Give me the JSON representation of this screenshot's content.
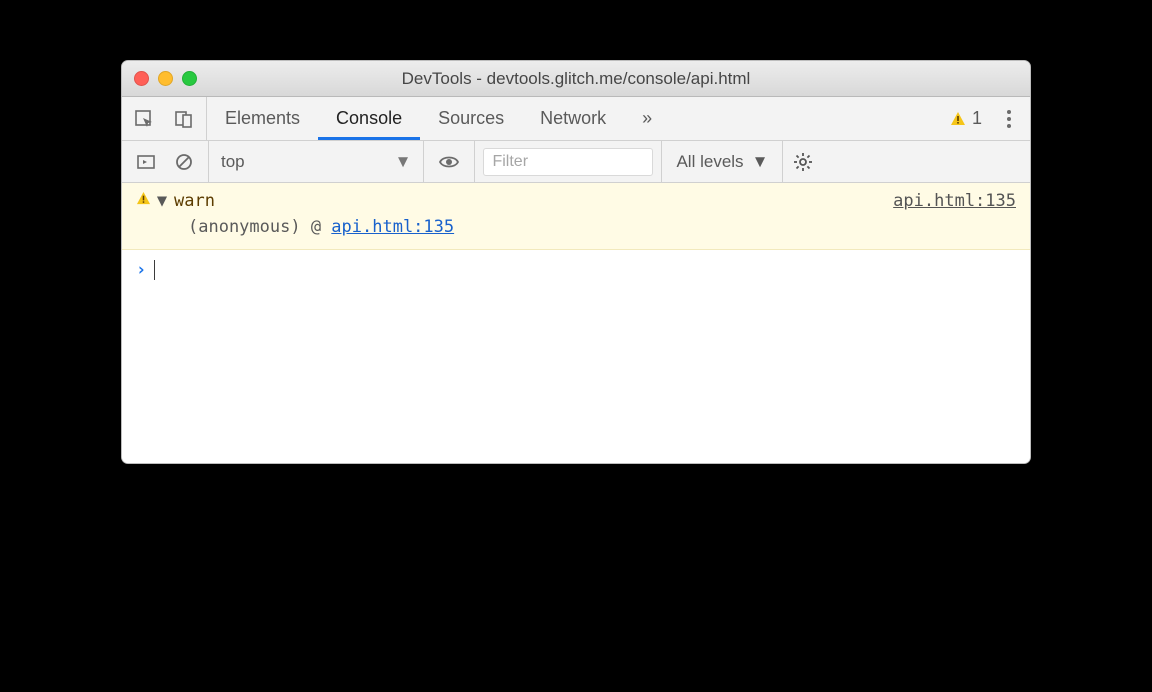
{
  "window": {
    "title": "DevTools - devtools.glitch.me/console/api.html"
  },
  "tabs": {
    "elements": "Elements",
    "console": "Console",
    "sources": "Sources",
    "network": "Network"
  },
  "warnings": {
    "count": "1"
  },
  "toolbar": {
    "context": "top",
    "filter_placeholder": "Filter",
    "levels_label": "All levels"
  },
  "message": {
    "text": "warn",
    "source": "api.html:135",
    "trace_label": "(anonymous) @ ",
    "trace_link": "api.html:135"
  }
}
